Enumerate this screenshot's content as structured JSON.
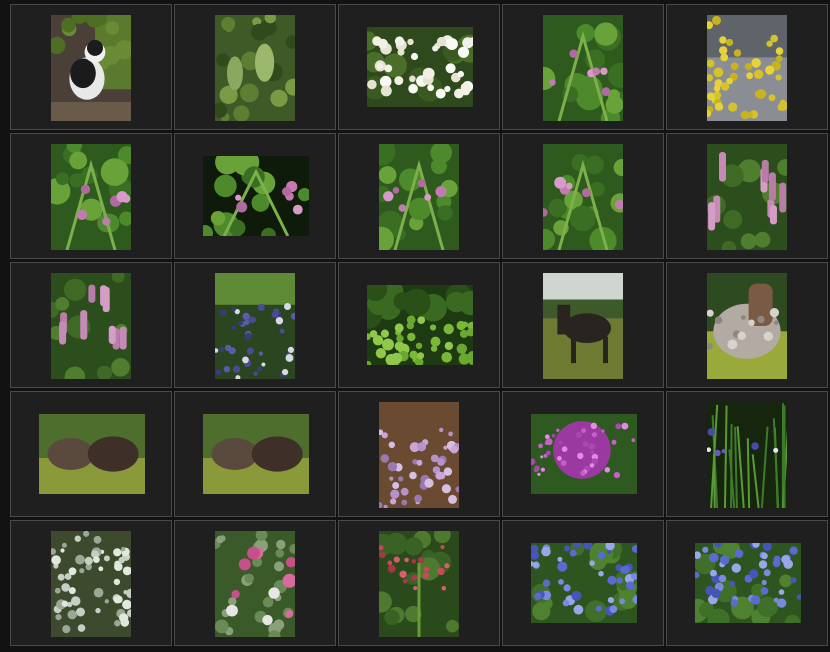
{
  "gallery": {
    "columns": 5,
    "rows": 5,
    "items": [
      {
        "subject": "cat-photo"
      },
      {
        "subject": "teasel-plant-photo"
      },
      {
        "subject": "white-elderflower-photo"
      },
      {
        "subject": "comfrey-flower-photo"
      },
      {
        "subject": "laburnum-yellow-flowers-photo"
      },
      {
        "subject": "comfrey-bells-photo"
      },
      {
        "subject": "comfrey-stem-photo"
      },
      {
        "subject": "comfrey-leaves-photo"
      },
      {
        "subject": "comfrey-blossom-photo"
      },
      {
        "subject": "bistort-pink-spikes-photo"
      },
      {
        "subject": "bistort-field-photo"
      },
      {
        "subject": "bugle-purple-flowers-photo"
      },
      {
        "subject": "boxwood-hedge-photo"
      },
      {
        "subject": "dark-horse-photo"
      },
      {
        "subject": "roan-horse-photo"
      },
      {
        "subject": "two-horses-photo"
      },
      {
        "subject": "horses-nuzzling-photo"
      },
      {
        "subject": "lilac-photo"
      },
      {
        "subject": "allium-purple-photo"
      },
      {
        "subject": "iris-garden-photo"
      },
      {
        "subject": "silver-foliage-photo"
      },
      {
        "subject": "pink-dianthus-photo"
      },
      {
        "subject": "red-valerian-photo"
      },
      {
        "subject": "blue-ceanothus-photo"
      },
      {
        "subject": "blue-hydrangea-photo"
      }
    ]
  },
  "colors": {
    "page_background": "#121212",
    "cell_background": "#1f1f1f",
    "cell_border": "#4a4a4a"
  }
}
